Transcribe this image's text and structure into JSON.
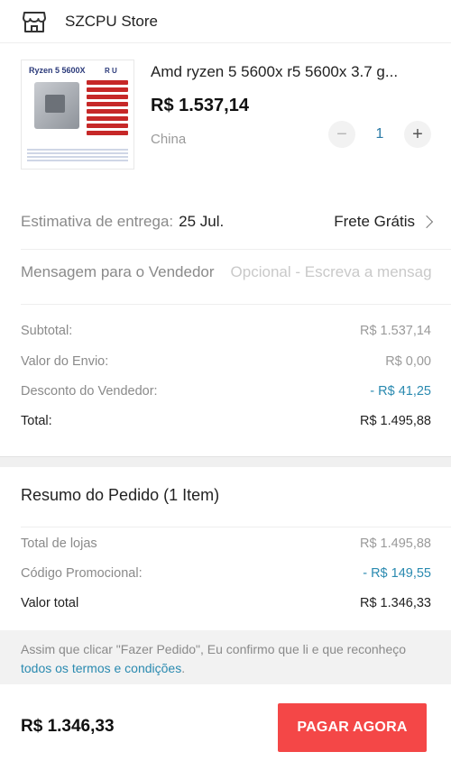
{
  "store": {
    "name": "SZCPU Store",
    "icon": "store-icon"
  },
  "product": {
    "thumb_title": "Ryzen 5 5600X",
    "thumb_badge": "R U",
    "title": "Amd ryzen 5 5600x r5 5600x 3.7 g...",
    "price": "R$ 1.537,14",
    "origin": "China",
    "quantity": "1",
    "minus": "−",
    "plus": "+"
  },
  "delivery": {
    "label": "Estimativa de entrega:",
    "date": "25 Jul.",
    "shipping": "Frete Grátis"
  },
  "message": {
    "label": "Mensagem para o Vendedor",
    "placeholder": "Opcional - Escreva a mensagem"
  },
  "summary": {
    "subtotal_label": "Subtotal:",
    "subtotal_value": "R$ 1.537,14",
    "shipping_label": "Valor do Envio:",
    "shipping_value": "R$ 0,00",
    "discount_label": "Desconto do Vendedor:",
    "discount_value": "- R$ 41,25",
    "total_label": "Total:",
    "total_value": "R$ 1.495,88"
  },
  "order": {
    "title": "Resumo do Pedido (1 Item)",
    "stores_label": "Total de lojas",
    "stores_value": "R$ 1.495,88",
    "promo_label": "Código Promocional:",
    "promo_value": "- R$ 149,55",
    "total_label": "Valor total",
    "total_value": "R$ 1.346,33"
  },
  "notice": {
    "text": "Assim que clicar \"Fazer Pedido\", Eu confirmo que li e que reconheço ",
    "link": "todos os termos e condições",
    "end": "."
  },
  "footer": {
    "total": "R$ 1.346,33",
    "pay_button": "PAGAR AGORA"
  },
  "colors": {
    "accent_red": "#f44747",
    "link_blue": "#2a8ab0"
  }
}
